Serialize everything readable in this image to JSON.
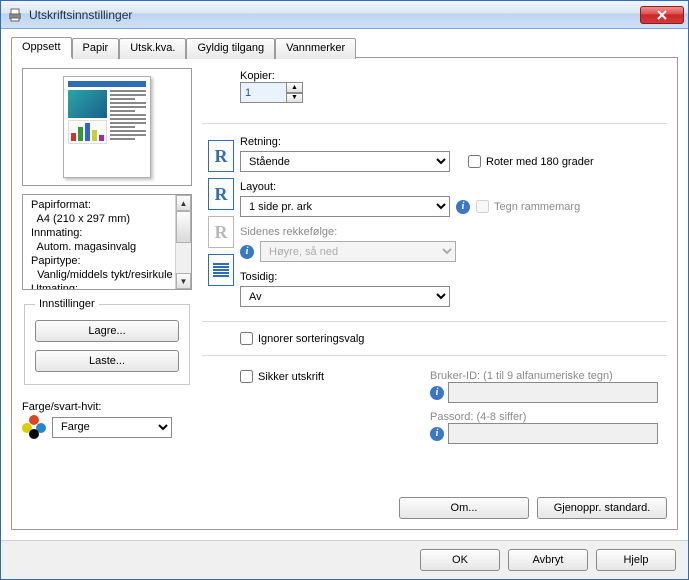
{
  "window": {
    "title": "Utskriftsinnstillinger"
  },
  "tabs": {
    "t0": "Oppsett",
    "t1": "Papir",
    "t2": "Utsk.kva.",
    "t3": "Gyldig tilgang",
    "t4": "Vannmerker"
  },
  "copies": {
    "label": "Kopier:",
    "value": "1"
  },
  "orientation": {
    "label": "Retning:",
    "value": "Stående",
    "rotate_label": "Roter med 180 grader"
  },
  "layout": {
    "label": "Layout:",
    "value": "1 side pr. ark",
    "frame_label": "Tegn rammemarg"
  },
  "pageorder": {
    "label": "Sidenes rekkefølge:",
    "value": "Høyre, så ned"
  },
  "duplex": {
    "label": "Tosidig:",
    "value": "Av"
  },
  "paper_info": "Papirformat:\n  A4 (210 x 297 mm)\nInnmating:\n  Autom. magasinvalg\nPapirtype:\n  Vanlig/middels tykt/resirkule\nUtmating:",
  "settings_group": {
    "legend": "Innstillinger",
    "save": "Lagre...",
    "load": "Laste..."
  },
  "color": {
    "label": "Farge/svart-hvit:",
    "value": "Farge"
  },
  "ignore_sort": "Ignorer sorteringsvalg",
  "secure": {
    "checkbox": "Sikker utskrift",
    "user_label": "Bruker-ID: (1 til 9 alfanumeriske tegn)",
    "pass_label": "Passord: (4-8 siffer)"
  },
  "actions": {
    "about": "Om...",
    "restore": "Gjenoppr. standard."
  },
  "footer": {
    "ok": "OK",
    "cancel": "Avbryt",
    "help": "Hjelp"
  }
}
